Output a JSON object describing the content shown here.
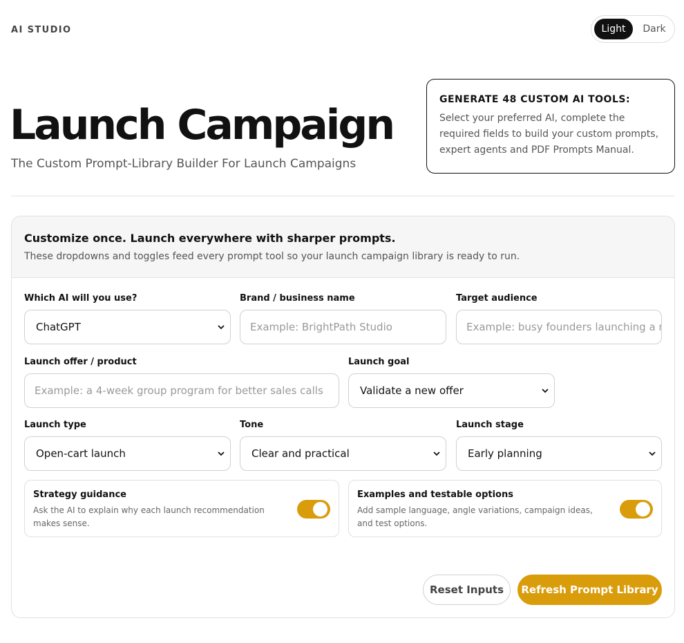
{
  "header": {
    "brand": "AI STUDIO",
    "theme": {
      "light_label": "Light",
      "dark_label": "Dark",
      "selected": "Light"
    }
  },
  "hero": {
    "title": "Launch Campaign",
    "subtitle": "The Custom Prompt-Library Builder For Launch Campaigns"
  },
  "promo": {
    "title": "GENERATE 48 CUSTOM AI TOOLS:",
    "text": "Select your preferred AI, complete the required fields to build your custom prompts, expert agents and PDF Prompts Manual."
  },
  "panel": {
    "heading": "Customize once. Launch everywhere with sharper prompts.",
    "description": "These dropdowns and toggles feed every prompt tool so your launch campaign library is ready to run.",
    "fields": {
      "ai": {
        "label": "Which AI will you use?",
        "value": "ChatGPT"
      },
      "brand": {
        "label": "Brand / business name",
        "placeholder": "Example: BrightPath Studio"
      },
      "audience": {
        "label": "Target audience",
        "placeholder": "Example: busy founders launching a ne"
      },
      "offer": {
        "label": "Launch offer / product",
        "placeholder": "Example: a 4-week group program for better sales calls"
      },
      "goal": {
        "label": "Launch goal",
        "value": "Validate a new offer"
      },
      "type": {
        "label": "Launch type",
        "value": "Open-cart launch"
      },
      "tone": {
        "label": "Tone",
        "value": "Clear and practical"
      },
      "stage": {
        "label": "Launch stage",
        "value": "Early planning"
      }
    },
    "toggles": {
      "strategy": {
        "title": "Strategy guidance",
        "description": "Ask the AI to explain why each launch recommendation makes sense.",
        "on": true
      },
      "examples": {
        "title": "Examples and testable options",
        "description": "Add sample language, angle variations, campaign ideas, and test options.",
        "on": true
      }
    },
    "actions": {
      "reset_label": "Reset Inputs",
      "refresh_label": "Refresh Prompt Library"
    }
  },
  "colors": {
    "accent": "#d99c0a",
    "dark": "#111111",
    "muted": "#555555"
  }
}
